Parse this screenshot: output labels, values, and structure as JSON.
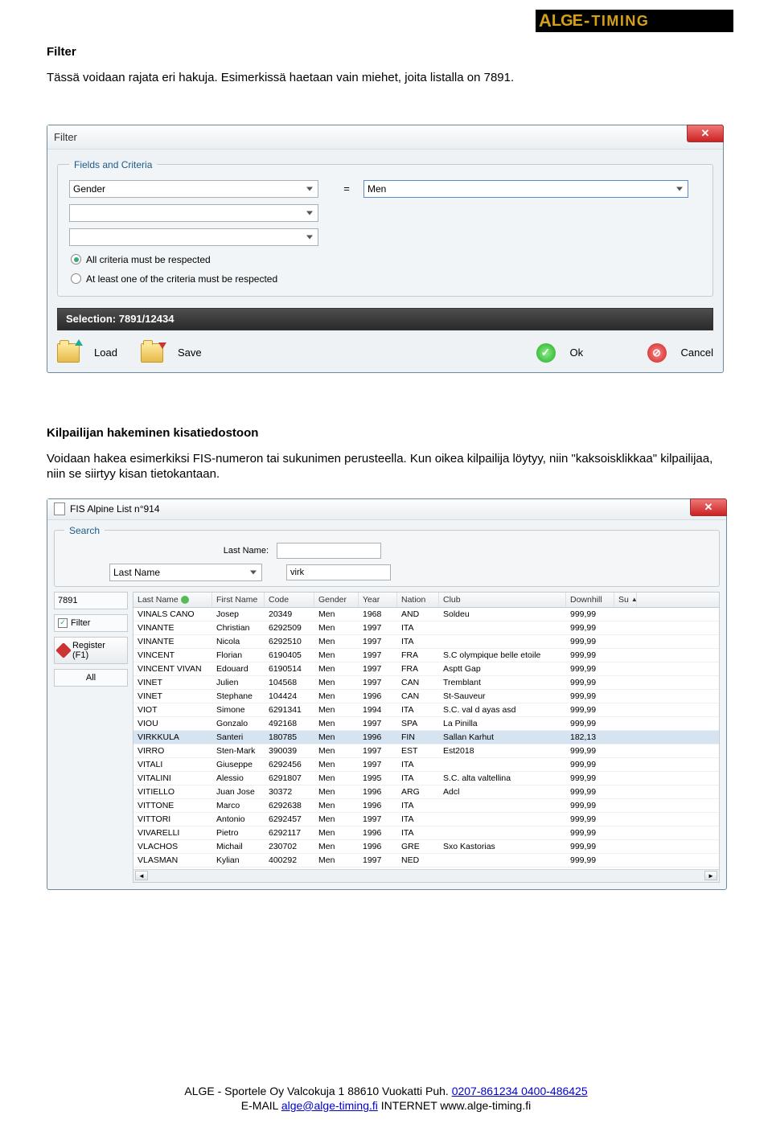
{
  "logo": {
    "brand": "ALGE",
    "suffix": "-TIMING"
  },
  "section1": {
    "heading": "Filter",
    "text": "Tässä voidaan rajata eri hakuja. Esimerkissä haetaan vain miehet, joita listalla on 7891."
  },
  "filter_dialog": {
    "title": "Filter",
    "fieldset_legend": "Fields and Criteria",
    "field1": "Gender",
    "eq": "=",
    "value1": "Men",
    "radio1": "All criteria must be respected",
    "radio2": "At least one of the criteria must be respected",
    "selection_label": "Selection: 7891/12434",
    "load": "Load",
    "save": "Save",
    "ok": "Ok",
    "cancel": "Cancel"
  },
  "section2": {
    "heading": "Kilpailijan hakeminen kisatiedostoon",
    "text": "Voidaan hakea esimerkiksi FIS-numeron tai sukunimen perusteella. Kun oikea kilpailija löytyy, niin \"kaksoisklikkaa\" kilpailijaa, niin se siirtyy kisan tietokantaan."
  },
  "fis_dialog": {
    "title": "FIS Alpine List n°914",
    "search_legend": "Search",
    "lastname_lbl": "Last Name:",
    "lastname_combo": "Last Name",
    "lastname_val": "virk",
    "count": "7891",
    "filter_chk": "Filter",
    "register": "Register (F1)",
    "all": "All",
    "headers": [
      "Last Name",
      "First Name",
      "Code",
      "Gender",
      "Year",
      "Nation",
      "Club",
      "Downhill",
      "Su"
    ],
    "rows": [
      [
        "VINALS CANO",
        "Josep",
        "20349",
        "Men",
        "1968",
        "AND",
        "Soldeu",
        "999,99",
        ""
      ],
      [
        "VINANTE",
        "Christian",
        "6292509",
        "Men",
        "1997",
        "ITA",
        "",
        "999,99",
        ""
      ],
      [
        "VINANTE",
        "Nicola",
        "6292510",
        "Men",
        "1997",
        "ITA",
        "",
        "999,99",
        ""
      ],
      [
        "VINCENT",
        "Florian",
        "6190405",
        "Men",
        "1997",
        "FRA",
        "S.C olympique belle etoile",
        "999,99",
        ""
      ],
      [
        "VINCENT VIVAN",
        "Edouard",
        "6190514",
        "Men",
        "1997",
        "FRA",
        "Asptt Gap",
        "999,99",
        ""
      ],
      [
        "VINET",
        "Julien",
        "104568",
        "Men",
        "1997",
        "CAN",
        "Tremblant",
        "999,99",
        ""
      ],
      [
        "VINET",
        "Stephane",
        "104424",
        "Men",
        "1996",
        "CAN",
        "St-Sauveur",
        "999,99",
        ""
      ],
      [
        "VIOT",
        "Simone",
        "6291341",
        "Men",
        "1994",
        "ITA",
        "S.C. val d ayas asd",
        "999,99",
        ""
      ],
      [
        "VIOU",
        "Gonzalo",
        "492168",
        "Men",
        "1997",
        "SPA",
        "La Pinilla",
        "999,99",
        ""
      ],
      [
        "VIRKKULA",
        "Santeri",
        "180785",
        "Men",
        "1996",
        "FIN",
        "Sallan Karhut",
        "182,13",
        ""
      ],
      [
        "VIRRO",
        "Sten-Mark",
        "390039",
        "Men",
        "1997",
        "EST",
        "Est2018",
        "999,99",
        ""
      ],
      [
        "VITALI",
        "Giuseppe",
        "6292456",
        "Men",
        "1997",
        "ITA",
        "",
        "999,99",
        ""
      ],
      [
        "VITALINI",
        "Alessio",
        "6291807",
        "Men",
        "1995",
        "ITA",
        "S.C. alta valtellina",
        "999,99",
        ""
      ],
      [
        "VITIELLO",
        "Juan Jose",
        "30372",
        "Men",
        "1996",
        "ARG",
        "Adcl",
        "999,99",
        ""
      ],
      [
        "VITTONE",
        "Marco",
        "6292638",
        "Men",
        "1996",
        "ITA",
        "",
        "999,99",
        ""
      ],
      [
        "VITTORI",
        "Antonio",
        "6292457",
        "Men",
        "1997",
        "ITA",
        "",
        "999,99",
        ""
      ],
      [
        "VIVARELLI",
        "Pietro",
        "6292117",
        "Men",
        "1996",
        "ITA",
        "",
        "999,99",
        ""
      ],
      [
        "VLACHOS",
        "Michail",
        "230702",
        "Men",
        "1996",
        "GRE",
        "Sxo Kastorias",
        "999,99",
        ""
      ],
      [
        "VLASMAN",
        "Kylian",
        "400292",
        "Men",
        "1997",
        "NED",
        "",
        "999,99",
        ""
      ]
    ],
    "selected_row_index": 9
  },
  "footer": {
    "line1_a": "ALGE - Sportele Oy Valcokuja 1 88610 Vuokatti  Puh. ",
    "line1_b": "0207-861234  0400-486425",
    "line2_a": "E-MAIL ",
    "email": "alge@alge-timing.fi",
    "line2_b": "  INTERNET  www.alge-timing.fi"
  }
}
